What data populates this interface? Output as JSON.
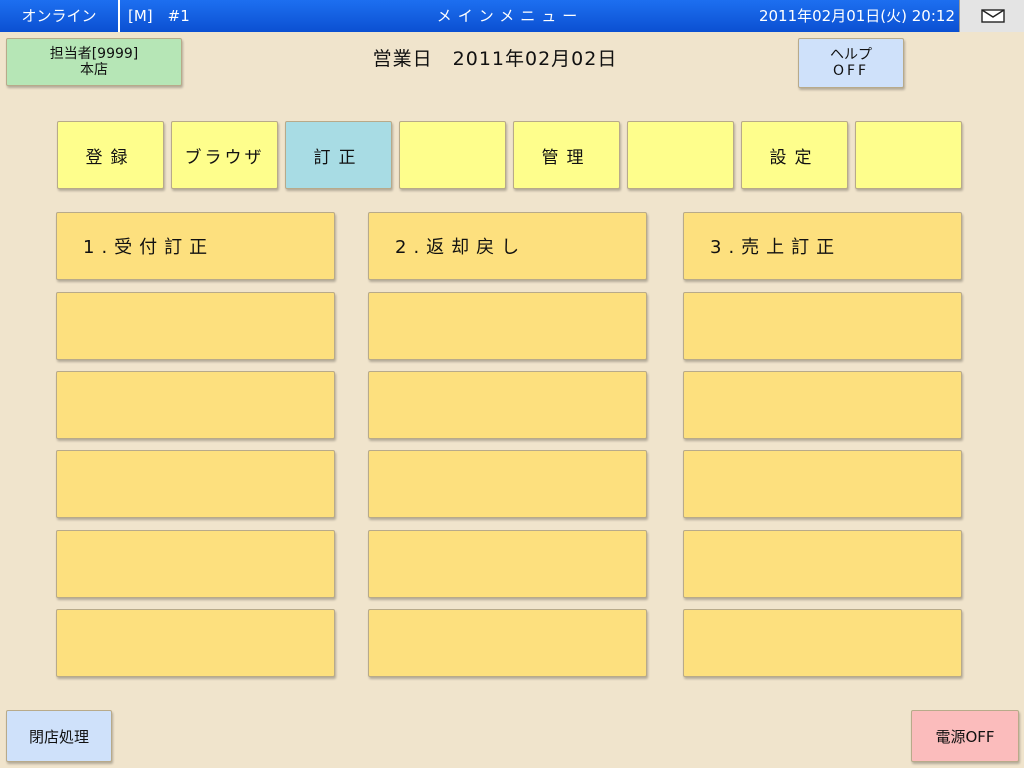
{
  "topbar": {
    "status": "オンライン",
    "mode": "[M]　#1",
    "title": "メインメニュー",
    "datetime": "2011年02月01日(火) 20:12",
    "mail_icon": "mail-icon"
  },
  "header": {
    "staff_line1": "担当者[9999]",
    "staff_line2": "本店",
    "business_date": "営業日　2011年02月02日",
    "help_line1": "ヘルプ",
    "help_line2": "OFF"
  },
  "tabs": [
    {
      "label": "登録"
    },
    {
      "label": "ブラウザ"
    },
    {
      "label": "訂正",
      "active": true
    },
    {
      "label": ""
    },
    {
      "label": "管理"
    },
    {
      "label": ""
    },
    {
      "label": "設定"
    },
    {
      "label": ""
    }
  ],
  "menu": {
    "col1": [
      "1.受付訂正",
      "",
      "",
      "",
      "",
      ""
    ],
    "col2": [
      "2.返却戻し",
      "",
      "",
      "",
      "",
      ""
    ],
    "col3": [
      "3.売上訂正",
      "",
      "",
      "",
      "",
      ""
    ]
  },
  "footer": {
    "close_shop": "閉店処理",
    "power_off": "電源OFF"
  },
  "colors": {
    "topbar": "#1d6ff0",
    "background": "#f0e4cc",
    "tab": "#fefe8c",
    "tab_active": "#a8dce4",
    "menu": "#fde07e",
    "staff": "#b6e6b6",
    "help": "#cfe1fa",
    "power": "#fbbcbc"
  }
}
